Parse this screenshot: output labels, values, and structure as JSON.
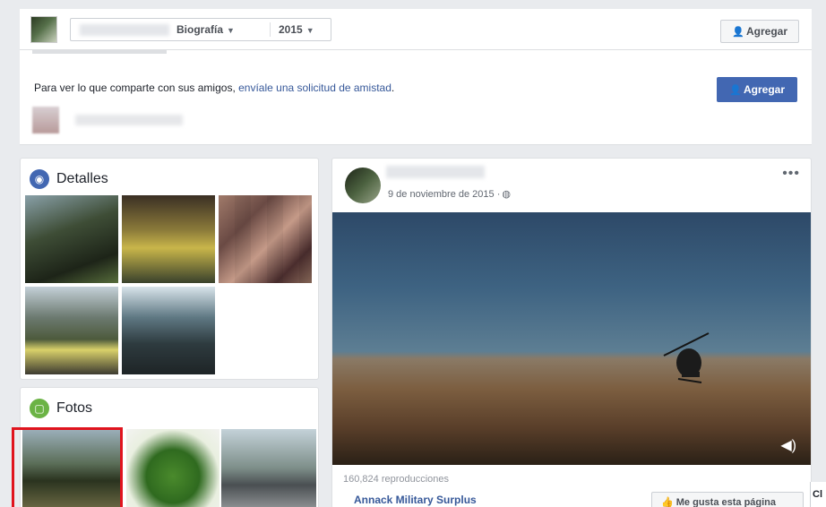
{
  "header": {
    "timeline_label": "Biografía",
    "year_label": "2015",
    "add_friend_label": "Agregar"
  },
  "friend_request": {
    "message_prefix": "Para ver lo que comparte con sus amigos, ",
    "message_link": "envíale una solicitud de amistad",
    "message_suffix": ".",
    "add_button_label": "Agregar"
  },
  "sidebar": {
    "details_title": "Detalles",
    "photos_title": "Fotos"
  },
  "post": {
    "date": "9 de noviembre de 2015 ·",
    "views": "160,824 reproducciones",
    "page_name": "Annack Military Surplus",
    "like_page_label": "Me gusta esta página"
  },
  "chat": {
    "label": "Cl"
  },
  "colors": {
    "primary_blue": "#4267b2",
    "link_blue": "#365899",
    "highlight_red": "#e0141e"
  }
}
